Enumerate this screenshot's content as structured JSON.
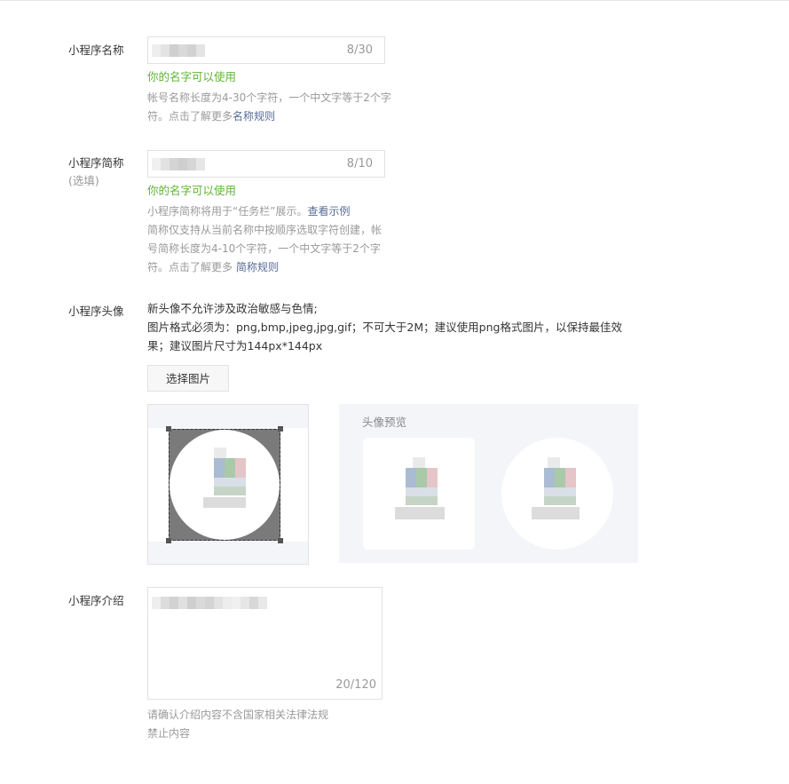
{
  "name_field": {
    "label": "小程序名称",
    "counter": "8/30",
    "ok_tip": "你的名字可以使用",
    "hint_text": "帐号名称长度为4-30个字符，一个中文字等于2个字符。点击了解更多",
    "hint_link": "名称规则"
  },
  "short_name_field": {
    "label": "小程序简称",
    "sublabel": "(选填)",
    "counter": "8/10",
    "ok_tip": "你的名字可以使用",
    "hint_line1": "小程序简称将用于“任务栏”展示。",
    "hint_line1_link": "查看示例",
    "hint_line2": "简称仅支持从当前名称中按顺序选取字符创建，帐号简称长度为4-10个字符，一个中文字等于2个字符。点击了解更多 ",
    "hint_link": "简称规则"
  },
  "avatar": {
    "label": "小程序头像",
    "desc_line1": "新头像不允许涉及政治敏感与色情;",
    "desc_line2": "图片格式必须为：png,bmp,jpeg,jpg,gif；不可大于2M；建议使用png格式图片，以保持最佳效果；建议图片尺寸为144px*144px",
    "select_button": "选择图片",
    "preview_title": "头像预览"
  },
  "intro": {
    "label": "小程序介绍",
    "counter": "20/120",
    "hint_line1": "请确认介绍内容不含国家相关法律法规",
    "hint_line2": "禁止内容"
  },
  "colors": {
    "ok_green": "#5fb336",
    "link_blue": "#576b95",
    "hint_gray": "#9a9a9a"
  }
}
